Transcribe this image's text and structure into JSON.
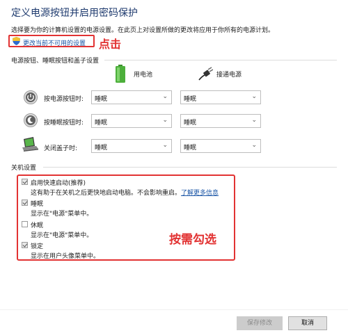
{
  "header": {
    "title": "定义电源按钮并启用密码保护",
    "description": "选择要为你的计算机设置的电源设置。在此页上对设置所做的更改将应用于你所有的电源计划。",
    "change_link": "更改当前不可用的设置",
    "annotation_click": "点击"
  },
  "power_section": {
    "label": "电源按钮、睡眠按钮和盖子设置",
    "col_battery": "用电池",
    "col_plugged": "接通电源",
    "rows": [
      {
        "label": "按电源按钮时:",
        "battery": "睡眠",
        "plugged": "睡眠",
        "icon": "power-button-icon"
      },
      {
        "label": "按睡眠按钮时:",
        "battery": "睡眠",
        "plugged": "睡眠",
        "icon": "sleep-button-icon"
      },
      {
        "label": "关闭盖子时:",
        "battery": "睡眠",
        "plugged": "睡眠",
        "icon": "laptop-lid-icon"
      }
    ]
  },
  "shutdown_section": {
    "label": "关机设置",
    "options": [
      {
        "title": "启用快速启动(推荐)",
        "desc": "这有助于在关机之后更快地启动电脑。不会影响重启。",
        "link": "了解更多信息",
        "checked": true
      },
      {
        "title": "睡眠",
        "desc": "显示在\"电源\"菜单中。",
        "checked": true
      },
      {
        "title": "休眠",
        "desc": "显示在\"电源\"菜单中。",
        "checked": false
      },
      {
        "title": "锁定",
        "desc": "显示在用户头像菜单中。",
        "checked": true
      }
    ],
    "annotation_choose": "按需勾选"
  },
  "footer": {
    "save_label": "保存修改",
    "cancel_label": "取消"
  },
  "colors": {
    "annotation_red": "#e23232",
    "link_blue": "#1a55a6",
    "title_blue": "#1e3a6e"
  }
}
